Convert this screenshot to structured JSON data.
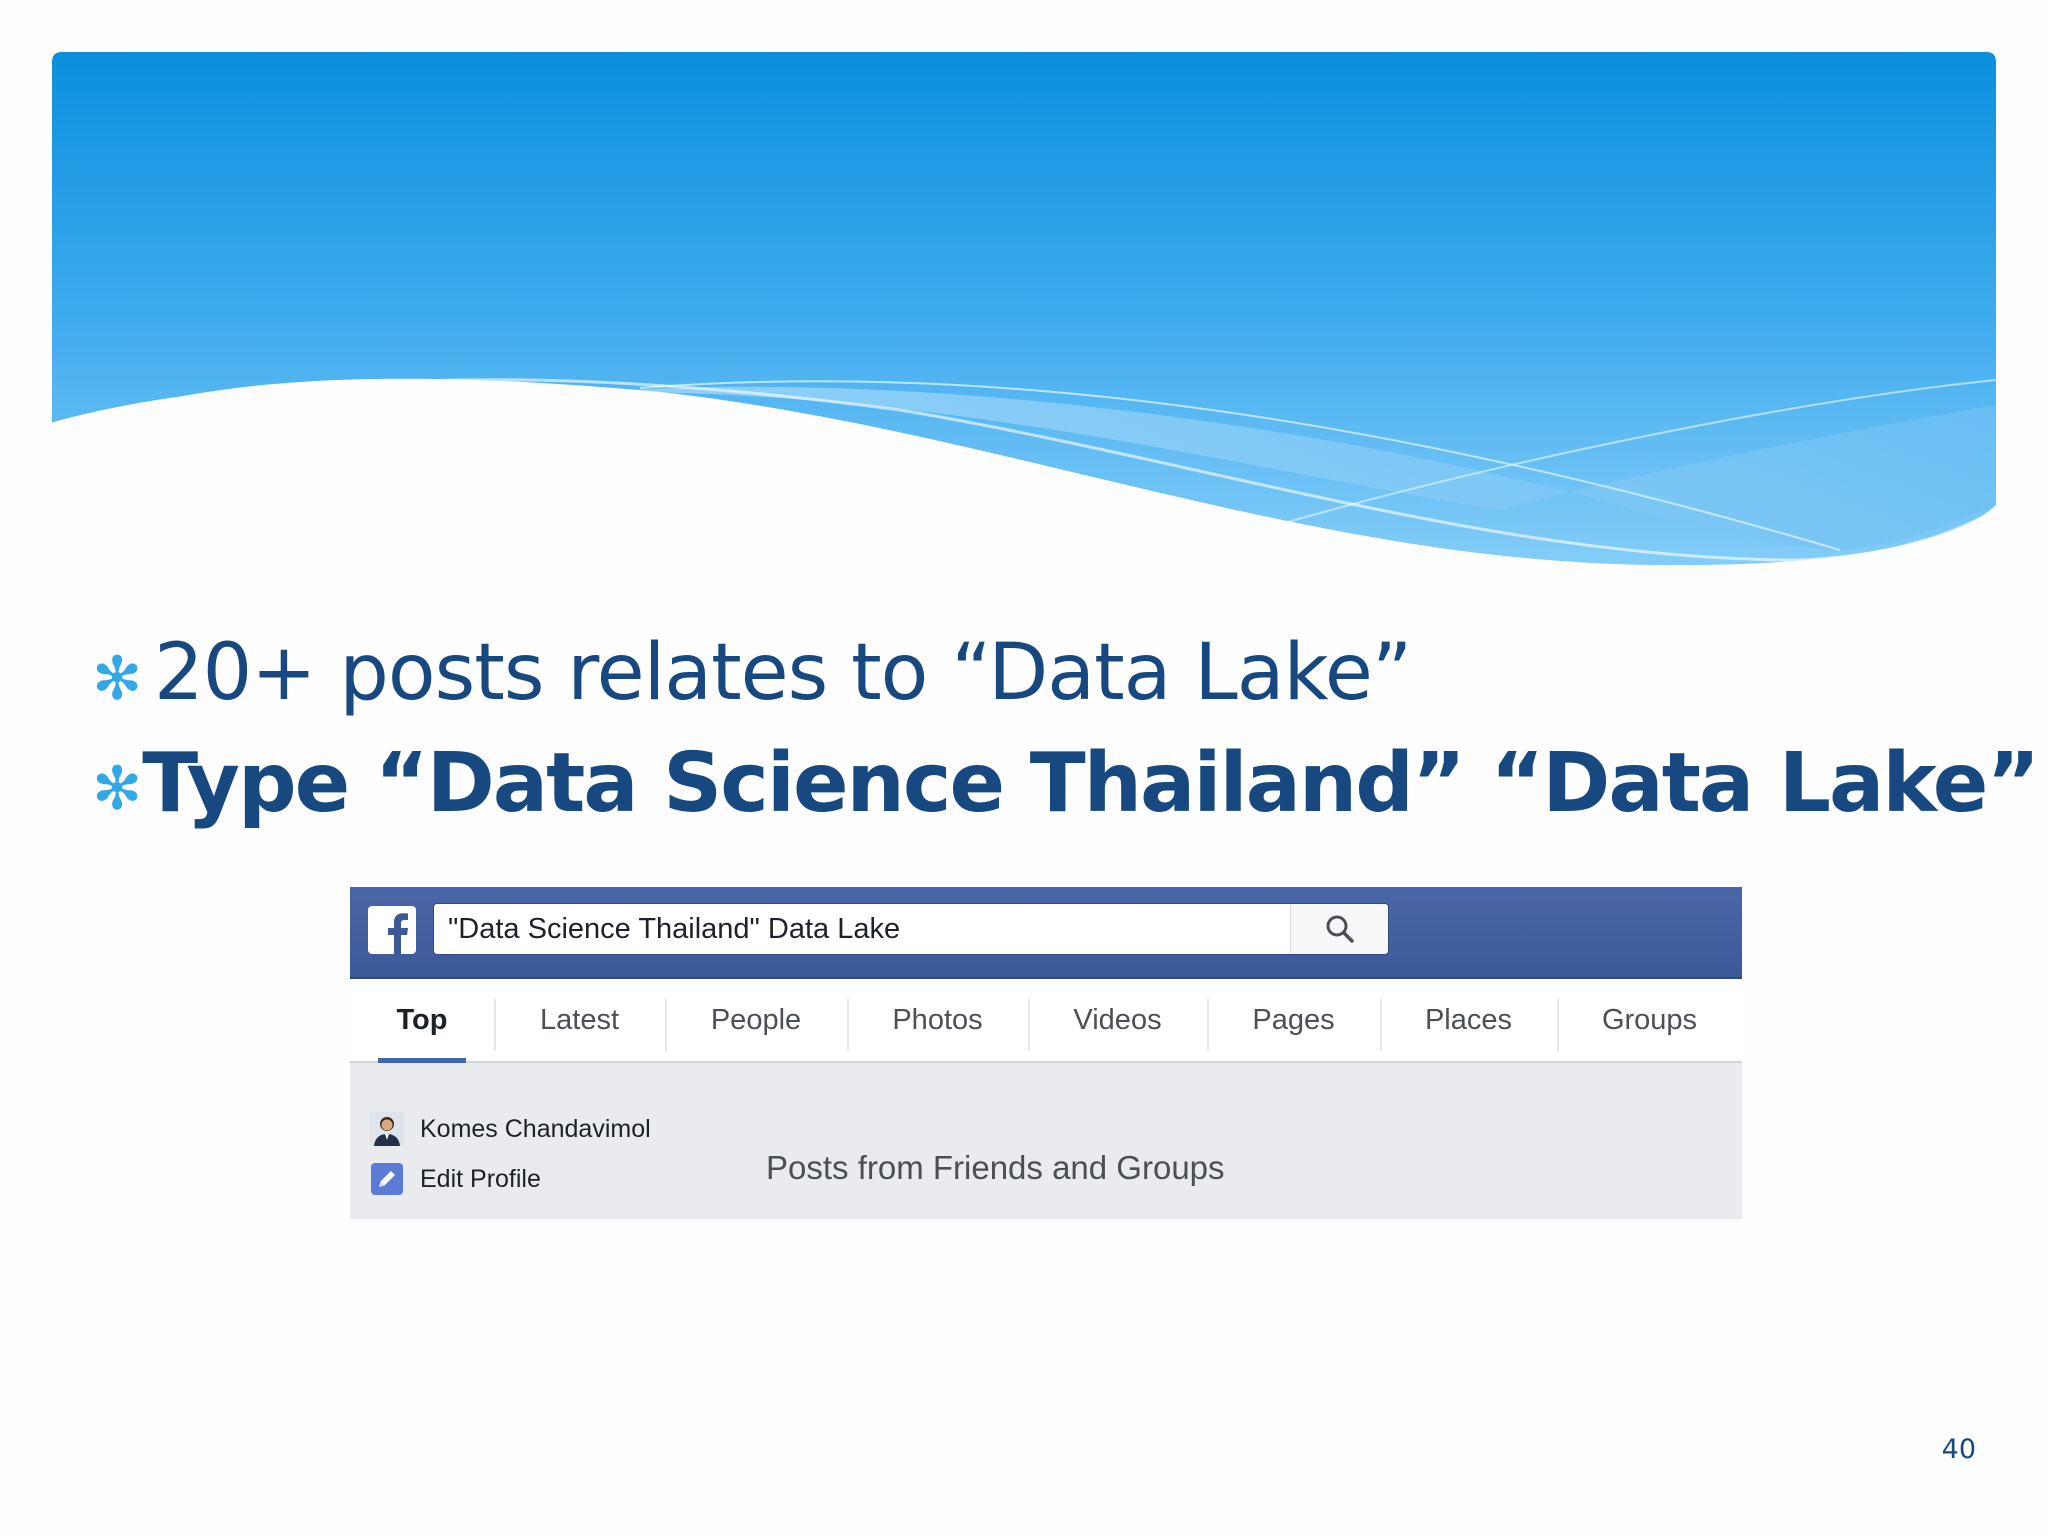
{
  "slide": {
    "bullets": [
      "20+ posts relates to “Data Lake”",
      "Type “Data Science Thailand” “Data Lake”"
    ],
    "page_number": "40"
  },
  "facebook": {
    "search_query": "\"Data Science Thailand\" Data Lake",
    "tabs": [
      "Top",
      "Latest",
      "People",
      "Photos",
      "Videos",
      "Pages",
      "Places",
      "Groups"
    ],
    "active_tab": "Top",
    "sidebar": {
      "profile_name": "Komes Chandavimol",
      "edit_profile": "Edit Profile"
    },
    "section_title": "Posts from Friends and Groups",
    "icons": [
      "facebook-logo-icon",
      "search-icon",
      "avatar",
      "pencil-icon"
    ]
  },
  "colors": {
    "header_blue": "#0f93e0",
    "text_navy": "#17487f",
    "bullet_star": "#33a8e6",
    "fb_bar": "#3b5998"
  }
}
